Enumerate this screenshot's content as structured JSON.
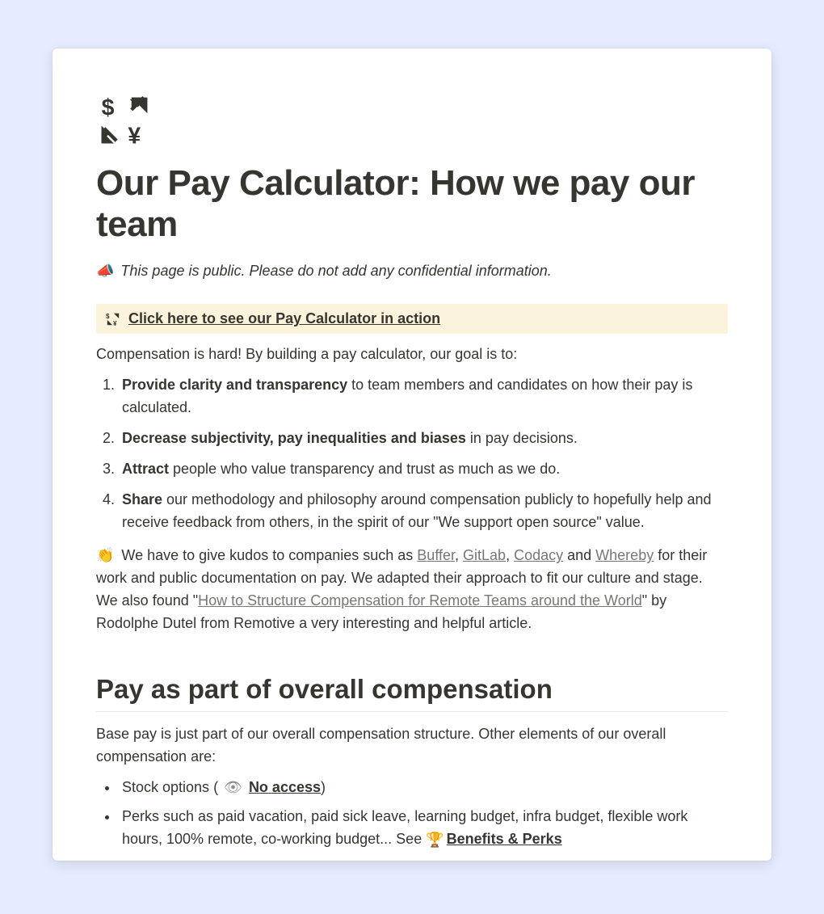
{
  "page": {
    "title": "Our Pay Calculator: How we pay our team"
  },
  "notice": {
    "emoji": "📣",
    "text": "This page is public. Please do not add any confidential information."
  },
  "callout": {
    "link_text": "Click here to see our Pay Calculator in action"
  },
  "intro": "Compensation is hard! By building a pay calculator, our goal is to:",
  "goals": [
    {
      "bold": "Provide clarity and transparency",
      "rest": " to team members and candidates on how their pay is calculated."
    },
    {
      "bold": "Decrease subjectivity, pay inequalities and biases",
      "rest": " in pay decisions."
    },
    {
      "bold": "Attract",
      "rest": " people who value transparency and trust as much as we do."
    },
    {
      "bold": "Share",
      "rest": " our methodology and philosophy around compensation publicly to hopefully help and receive feedback from others, in the spirit of our \"We support open source\" value."
    }
  ],
  "kudos": {
    "emoji": "👏",
    "pre": " We have to give kudos to companies such as ",
    "links": {
      "buffer": "Buffer",
      "gitlab": "GitLab",
      "codacy": "Codacy",
      "whereby": "Whereby"
    },
    "mid1": ", ",
    "mid2": ", ",
    "mid3": " and ",
    "after_links": " for their work and public documentation on pay. We adapted their approach to fit our culture and stage. We also found \"",
    "article": "How to Structure Compensation for Remote Teams around the World",
    "tail": "\" by Rodolphe Dutel from Remotive a very interesting and helpful article."
  },
  "section": {
    "heading": "Pay as part of overall compensation",
    "intro": "Base pay is just part of our overall compensation structure. Other elements of our overall compensation are:",
    "bullet1": {
      "pre": "Stock options ( ",
      "no_access_icon": "👁",
      "no_access": "No access",
      "post": ")"
    },
    "bullet2": {
      "text": "Perks such as paid vacation, paid sick leave, learning budget, infra budget, flexible work hours, 100% remote, co-working budget... See ",
      "mention_icon": "🏆",
      "mention": "Benefits & Perks"
    }
  }
}
